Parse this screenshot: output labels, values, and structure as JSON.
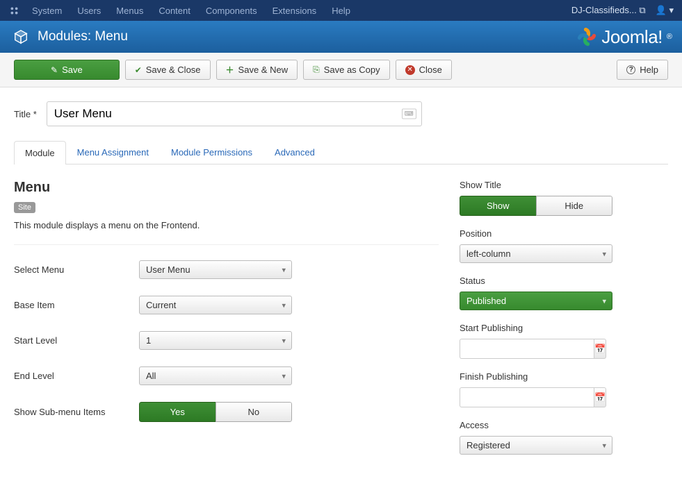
{
  "topnav": {
    "items": [
      "System",
      "Users",
      "Menus",
      "Content",
      "Components",
      "Extensions",
      "Help"
    ],
    "site_name": "DJ-Classifieds..."
  },
  "header": {
    "title": "Modules: Menu",
    "logo_text": "Joomla!"
  },
  "toolbar": {
    "save": "Save",
    "save_close": "Save & Close",
    "save_new": "Save & New",
    "save_copy": "Save as Copy",
    "close": "Close",
    "help": "Help"
  },
  "title_field": {
    "label": "Title *",
    "value": "User Menu"
  },
  "tabs": [
    "Module",
    "Menu Assignment",
    "Module Permissions",
    "Advanced"
  ],
  "module": {
    "heading": "Menu",
    "badge": "Site",
    "description": "This module displays a menu on the Frontend.",
    "fields": {
      "select_menu": {
        "label": "Select Menu",
        "value": "User Menu"
      },
      "base_item": {
        "label": "Base Item",
        "value": "Current"
      },
      "start_level": {
        "label": "Start Level",
        "value": "1"
      },
      "end_level": {
        "label": "End Level",
        "value": "All"
      },
      "show_sub": {
        "label": "Show Sub-menu Items",
        "yes": "Yes",
        "no": "No"
      }
    }
  },
  "sidebar": {
    "show_title": {
      "label": "Show Title",
      "show": "Show",
      "hide": "Hide"
    },
    "position": {
      "label": "Position",
      "value": "left-column"
    },
    "status": {
      "label": "Status",
      "value": "Published"
    },
    "start_pub": {
      "label": "Start Publishing",
      "value": ""
    },
    "finish_pub": {
      "label": "Finish Publishing",
      "value": ""
    },
    "access": {
      "label": "Access",
      "value": "Registered"
    }
  }
}
